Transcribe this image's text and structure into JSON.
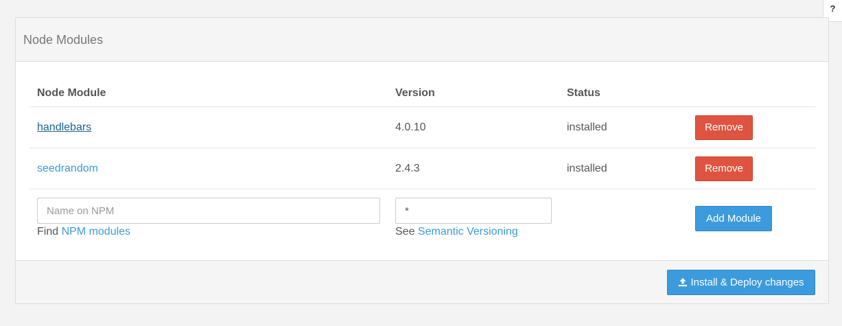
{
  "help": {
    "label": "?"
  },
  "panel": {
    "title": "Node Modules"
  },
  "table": {
    "columns": [
      "Node Module",
      "Version",
      "Status"
    ],
    "rows": [
      {
        "name": "handlebars",
        "version": "4.0.10",
        "status": "installed",
        "action": "Remove"
      },
      {
        "name": "seedrandom",
        "version": "2.4.3",
        "status": "installed",
        "action": "Remove"
      }
    ]
  },
  "add": {
    "name_placeholder": "Name on NPM",
    "version_value": "*",
    "name_hint_prefix": "Find",
    "name_hint_link": "NPM modules",
    "version_hint_prefix": "See",
    "version_hint_link": "Semantic Versioning",
    "button": "Add Module"
  },
  "footer": {
    "deploy_button": "Install & Deploy changes",
    "deploy_icon": "upload-icon"
  },
  "colors": {
    "link": "#3c9ad8",
    "danger": "#df5441",
    "primary": "#3b9bdc"
  }
}
